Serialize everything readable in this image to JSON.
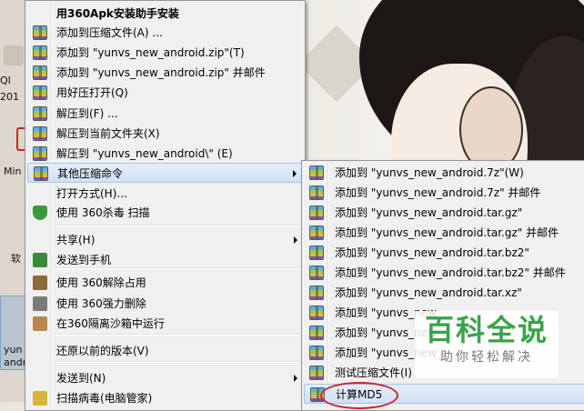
{
  "desktop": {
    "labels": [
      "QI",
      "201",
      "Min",
      "软",
      "yun",
      "andr"
    ]
  },
  "main_menu": {
    "items": [
      {
        "label": "用360Apk安装助手安装",
        "icon": "apk-installer-icon",
        "bold": true
      },
      {
        "label": "添加到压缩文件(A) ...",
        "icon": "archive-icon"
      },
      {
        "label": "添加到 \"yunvs_new_android.zip\"(T)",
        "icon": "archive-icon"
      },
      {
        "label": "添加到 \"yunvs_new_android.zip\" 并邮件",
        "icon": "archive-icon"
      },
      {
        "label": "用好压打开(Q)",
        "icon": "archive-icon"
      },
      {
        "label": "解压到(F) ...",
        "icon": "archive-icon"
      },
      {
        "label": "解压到当前文件夹(X)",
        "icon": "archive-icon"
      },
      {
        "label": "解压到 \"yunvs_new_android\\\" (E)",
        "icon": "archive-icon"
      },
      {
        "label": "其他压缩命令",
        "icon": "archive-icon",
        "submenu": true,
        "highlighted": true
      },
      {
        "label": "打开方式(H)...",
        "icon": ""
      },
      {
        "label": "使用 360杀毒 扫描",
        "icon": "shield-icon"
      },
      {
        "label": "共享(H)",
        "icon": "",
        "submenu": true
      },
      {
        "label": "发送到手机",
        "icon": "phone-icon"
      },
      {
        "label": "使用 360解除占用",
        "icon": "unlock-icon"
      },
      {
        "label": "使用 360强力删除",
        "icon": "shredder-icon"
      },
      {
        "label": "在360隔离沙箱中运行",
        "icon": "sandbox-icon"
      },
      {
        "label": "还原以前的版本(V)",
        "icon": ""
      },
      {
        "label": "发送到(N)",
        "icon": "",
        "submenu": true
      },
      {
        "label": "扫描病毒(电脑管家)",
        "icon": "virus-scan-icon"
      }
    ]
  },
  "sub_menu": {
    "items": [
      {
        "label": "添加到 \"yunvs_new_android.7z\"(W)"
      },
      {
        "label": "添加到 \"yunvs_new_android.7z\" 并邮件"
      },
      {
        "label": "添加到 \"yunvs_new_android.tar.gz\""
      },
      {
        "label": "添加到 \"yunvs_new_android.tar.gz\" 并邮件"
      },
      {
        "label": "添加到 \"yunvs_new_android.tar.bz2\""
      },
      {
        "label": "添加到 \"yunvs_new_android.tar.bz2\" 并邮件"
      },
      {
        "label": "添加到 \"yunvs_new_android.tar.xz\""
      },
      {
        "label": "添加到 \"yunvs_new_"
      },
      {
        "label": "添加到 \"yunvs_new_"
      },
      {
        "label": "添加到 \"yunvs_new_"
      },
      {
        "label": "测试压缩文件(I)"
      },
      {
        "label": "计算MD5"
      }
    ]
  },
  "watermark": {
    "big": "百科全说",
    "small": "助你轻松解决"
  }
}
